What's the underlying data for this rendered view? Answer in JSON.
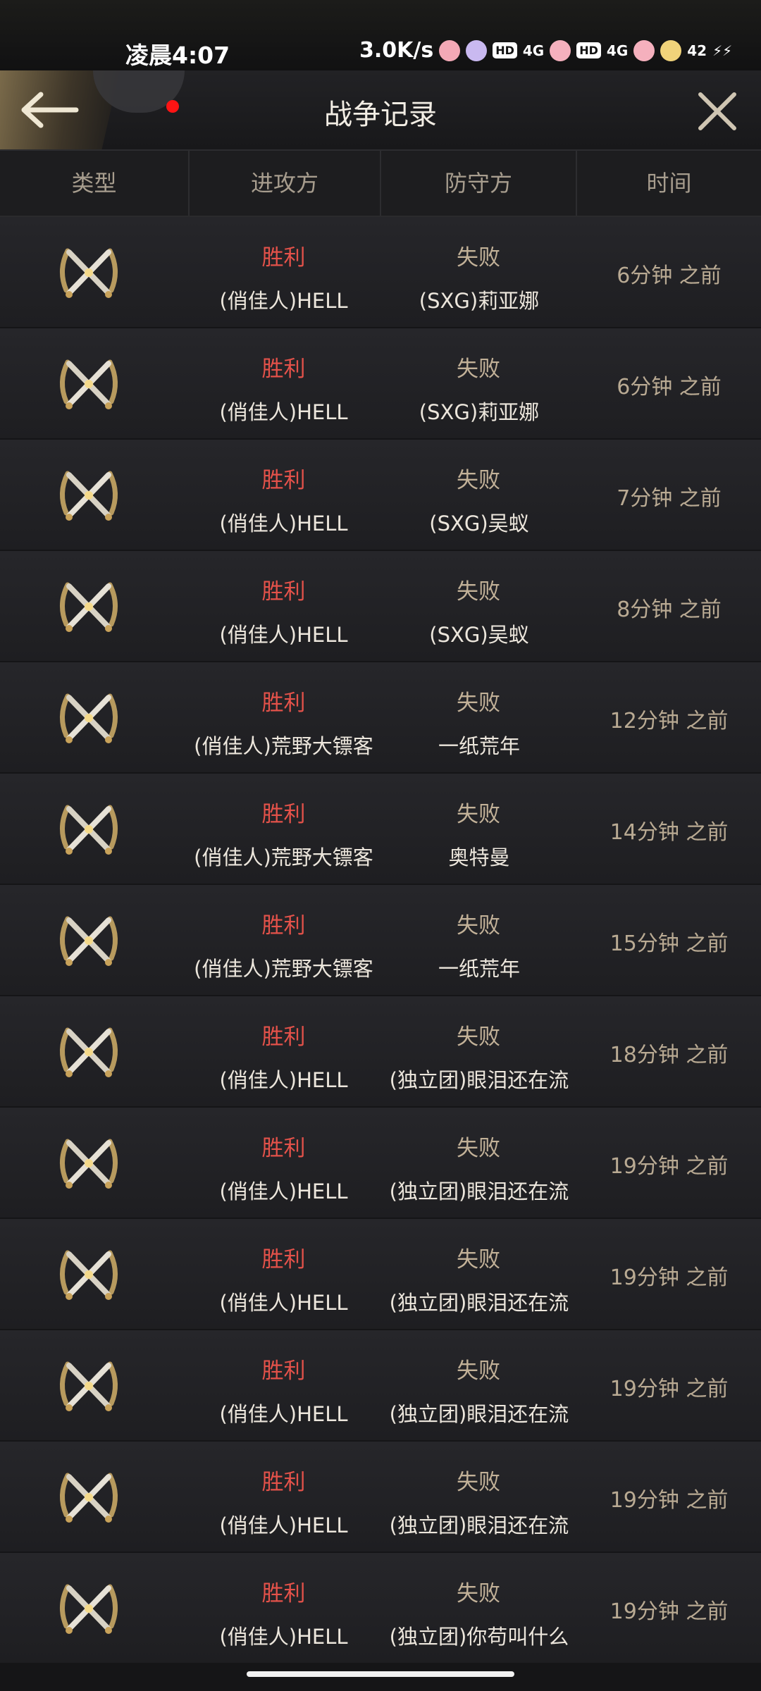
{
  "status_bar": {
    "time": "凌晨4:07",
    "speed": "3.0K/s",
    "hd1": "HD",
    "hd2": "HD",
    "net1": "4G",
    "net2": "4G",
    "battery": "42"
  },
  "header": {
    "title": "战争记录"
  },
  "columns": {
    "type": "类型",
    "attacker": "进攻方",
    "defender": "防守方",
    "time": "时间"
  },
  "records": [
    {
      "result_a": "胜利",
      "attacker": "(俏佳人)HELL",
      "result_d": "失败",
      "defender": "(SXG)莉亚娜",
      "time": "6分钟 之前"
    },
    {
      "result_a": "胜利",
      "attacker": "(俏佳人)HELL",
      "result_d": "失败",
      "defender": "(SXG)莉亚娜",
      "time": "6分钟 之前"
    },
    {
      "result_a": "胜利",
      "attacker": "(俏佳人)HELL",
      "result_d": "失败",
      "defender": "(SXG)吴蚁",
      "time": "7分钟 之前"
    },
    {
      "result_a": "胜利",
      "attacker": "(俏佳人)HELL",
      "result_d": "失败",
      "defender": "(SXG)吴蚁",
      "time": "8分钟 之前"
    },
    {
      "result_a": "胜利",
      "attacker": "(俏佳人)荒野大镖客",
      "result_d": "失败",
      "defender": "一纸荒年",
      "time": "12分钟 之前"
    },
    {
      "result_a": "胜利",
      "attacker": "(俏佳人)荒野大镖客",
      "result_d": "失败",
      "defender": "奥特曼",
      "time": "14分钟 之前"
    },
    {
      "result_a": "胜利",
      "attacker": "(俏佳人)荒野大镖客",
      "result_d": "失败",
      "defender": "一纸荒年",
      "time": "15分钟 之前"
    },
    {
      "result_a": "胜利",
      "attacker": "(俏佳人)HELL",
      "result_d": "失败",
      "defender": "(独立团)眼泪还在流",
      "time": "18分钟 之前"
    },
    {
      "result_a": "胜利",
      "attacker": "(俏佳人)HELL",
      "result_d": "失败",
      "defender": "(独立团)眼泪还在流",
      "time": "19分钟 之前"
    },
    {
      "result_a": "胜利",
      "attacker": "(俏佳人)HELL",
      "result_d": "失败",
      "defender": "(独立团)眼泪还在流",
      "time": "19分钟 之前"
    },
    {
      "result_a": "胜利",
      "attacker": "(俏佳人)HELL",
      "result_d": "失败",
      "defender": "(独立团)眼泪还在流",
      "time": "19分钟 之前"
    },
    {
      "result_a": "胜利",
      "attacker": "(俏佳人)HELL",
      "result_d": "失败",
      "defender": "(独立团)眼泪还在流",
      "time": "19分钟 之前"
    },
    {
      "result_a": "胜利",
      "attacker": "(俏佳人)HELL",
      "result_d": "失败",
      "defender": "(独立团)你苟叫什么",
      "time": "19分钟 之前"
    }
  ],
  "colors": {
    "win": "#e4524a",
    "lose": "#c2b198",
    "accent": "#b9aa93"
  }
}
